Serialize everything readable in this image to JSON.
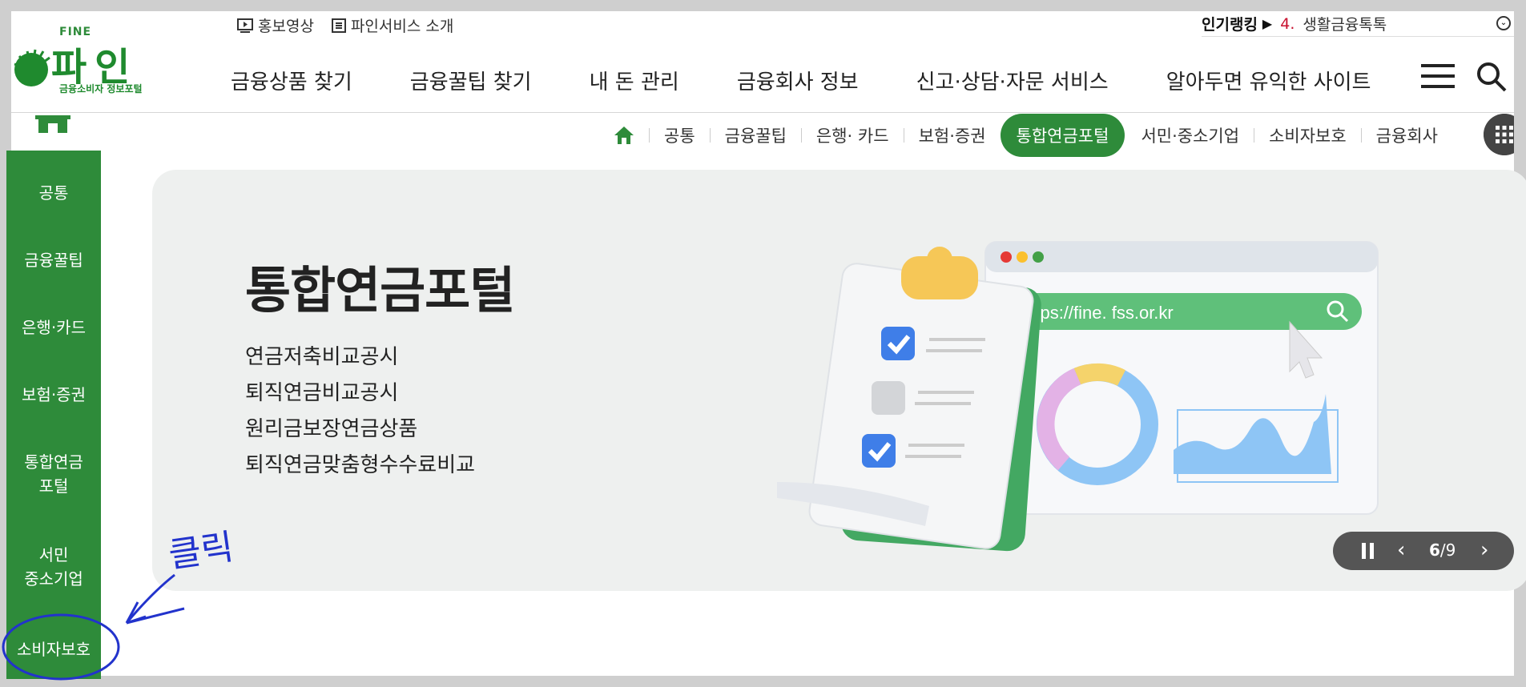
{
  "header": {
    "logo": {
      "eng": "FINE",
      "name": "파인",
      "tagline": "금융소비자 정보포털"
    },
    "top_links": [
      {
        "label": "홍보영상",
        "icon": "video-icon"
      },
      {
        "label": "파인서비스 소개",
        "icon": "list-icon"
      }
    ],
    "ranking": {
      "label": "인기랭킹",
      "rank": "4.",
      "text": "생활금융톡톡"
    },
    "gnb": [
      "금융상품 찾기",
      "금융꿀팁 찾기",
      "내 돈 관리",
      "금융회사 정보",
      "신고·상담·자문 서비스",
      "알아두면 유익한 사이트"
    ]
  },
  "tabs": {
    "items": [
      "공통",
      "금융꿀팁",
      "은행· 카드",
      "보험·증권",
      "통합연금포털",
      "서민·중소기업",
      "소비자보호",
      "금융회사"
    ],
    "active": "통합연금포털"
  },
  "sidebar": {
    "items": [
      "공통",
      "금융꿀팁",
      "은행·카드",
      "보험·증권",
      "통합연금\n포털",
      "서민\n중소기업",
      "소비자보호"
    ]
  },
  "hero": {
    "title": "통합연금포털",
    "list": [
      "연금저축비교공시",
      "퇴직연금비교공시",
      "원리금보장연금상품",
      "퇴직연금맞춤형수수료비교"
    ],
    "url": "https://fine. fss.or.kr"
  },
  "pager": {
    "current": "6",
    "total": "9",
    "separator": "/"
  },
  "annotation": {
    "text": "클릭"
  },
  "colors": {
    "brand_green": "#2e8b3a",
    "annotation_blue": "#2233cc",
    "rank_red": "#c8102e"
  }
}
